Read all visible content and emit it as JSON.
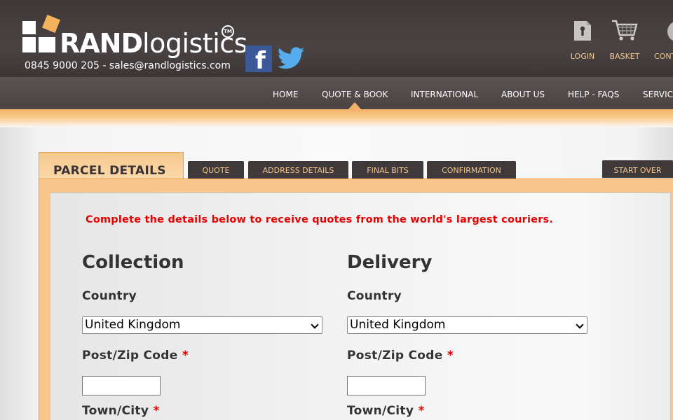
{
  "brand": {
    "name_bold": "RAND",
    "name_light": "logistics",
    "trademark": "TM",
    "contact": "0845 9000 205 - sales@randlogistics.com"
  },
  "social": {
    "facebook_glyph": "f"
  },
  "toolbar": {
    "login_label": "LOGIN",
    "basket_label": "BASKET",
    "contact_label": "CONT"
  },
  "nav": {
    "items": [
      "HOME",
      "QUOTE & BOOK",
      "INTERNATIONAL",
      "ABOUT US",
      "HELP - FAQS",
      "SERVIC"
    ],
    "active": "QUOTE & BOOK"
  },
  "steps": {
    "active": "PARCEL DETAILS",
    "tabs": [
      "QUOTE",
      "ADDRESS DETAILS",
      "FINAL BITS",
      "CONFIRMATION"
    ],
    "start_over": "START OVER"
  },
  "form": {
    "intro": "Complete the details below to receive quotes from the world's largest couriers.",
    "collection": {
      "title": "Collection",
      "country_label": "Country",
      "country_value": "United Kingdom",
      "postcode_label": "Post/Zip Code",
      "postcode_value": "",
      "town_label": "Town/City"
    },
    "delivery": {
      "title": "Delivery",
      "country_label": "Country",
      "country_value": "United Kingdom",
      "postcode_label": "Post/Zip Code",
      "postcode_value": "",
      "town_label": "Town/City"
    },
    "required_marker": "*"
  },
  "colors": {
    "header_bg": "#433c3c",
    "accent_orange": "#f5b25a",
    "nav_text": "#ffffff",
    "toolbar_text": "#f5c68a",
    "required": "#e60000"
  }
}
